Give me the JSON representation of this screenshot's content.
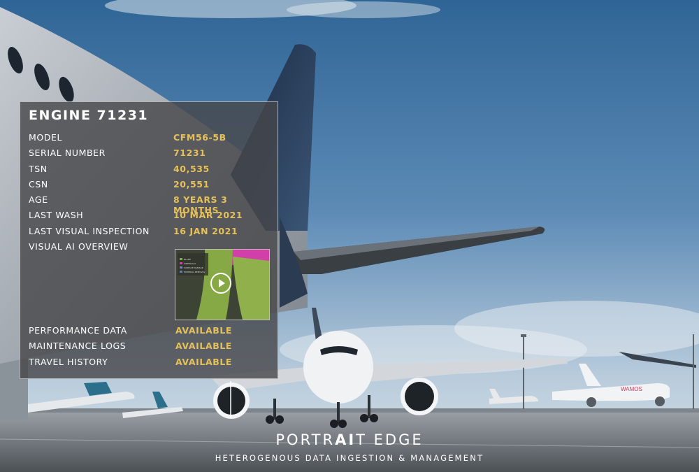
{
  "panel": {
    "title": "ENGINE 71231",
    "rows": [
      {
        "label": "MODEL",
        "value": "CFM56-5B"
      },
      {
        "label": "SERIAL NUMBER",
        "value": "71231"
      },
      {
        "label": "TSN",
        "value": "40,535"
      },
      {
        "label": "CSN",
        "value": "20,551"
      },
      {
        "label": "AGE",
        "value": "8 YEARS 3 MONTHS"
      },
      {
        "label": "LAST WASH",
        "value": "10 MAR 2021"
      },
      {
        "label": "LAST VISUAL INSPECTION",
        "value": "16 JAN 2021"
      }
    ],
    "overview_label": "VISUAL AI OVERVIEW",
    "video_legend": [
      "BLADE",
      "SIDEWALLS",
      "SURFACE DAMAGE",
      "MATERIAL REMOVAL"
    ],
    "links": [
      {
        "label": "PERFORMANCE DATA",
        "value": "AVAILABLE"
      },
      {
        "label": "MAINTENANCE LOGS",
        "value": "AVAILABLE"
      },
      {
        "label": "TRAVEL HISTORY",
        "value": "AVAILABLE"
      }
    ]
  },
  "brand": {
    "name_a": "PORTR",
    "name_b": "AI",
    "name_c": "T EDGE",
    "tagline": "HETEROGENOUS DATA INGESTION & MANAGEMENT"
  },
  "colors": {
    "accent": "#e6c15a",
    "panel": "#464648"
  },
  "aircraft_livery_text": "WAMOS"
}
